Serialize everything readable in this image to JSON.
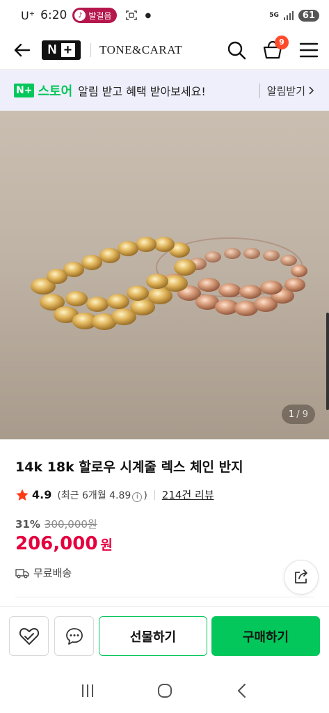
{
  "status_bar": {
    "carrier": "U⁺",
    "time": "6:20",
    "pill_label": "발걸음",
    "network": "5G",
    "battery": "61"
  },
  "header": {
    "logo": "N",
    "logo_plus": "+",
    "brand": "TONE&CARAT",
    "cart_count": "9"
  },
  "store_banner": {
    "logo_box": "N+",
    "logo_word": "스토어",
    "message": "알림 받고 혜택 받아보세요!",
    "alert_label": "알림받기"
  },
  "gallery": {
    "current": "1",
    "total": "/ 9"
  },
  "product": {
    "title": "14k 18k 할로우 시계줄 렉스 체인 반지",
    "rating": "4.9",
    "rating_note_prefix": "(최근 6개월 4.89",
    "rating_note_suffix": ")",
    "review_link": "214건 리뷰",
    "discount_rate": "31%",
    "original_price": "300,000원",
    "sale_price": "206,000",
    "sale_unit": "원",
    "shipping": "무료배송"
  },
  "actions": {
    "gift_label": "선물하기",
    "buy_label": "구매하기"
  },
  "colors": {
    "accent_green": "#03c75a",
    "price_red": "#e5003e",
    "cart_badge": "#ff4b2b",
    "status_pill": "#b5174c"
  }
}
